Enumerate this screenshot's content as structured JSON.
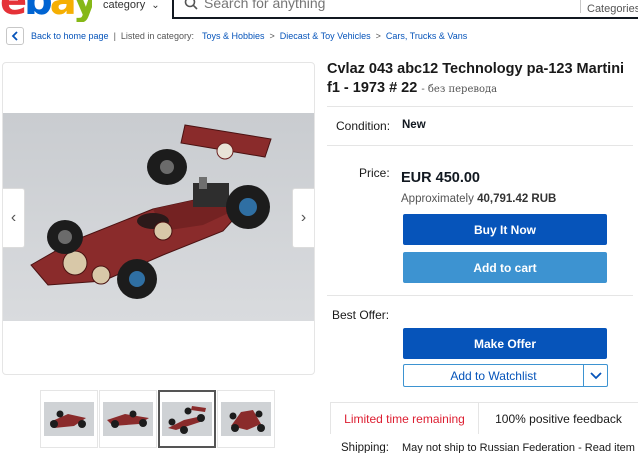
{
  "header": {
    "logo_text": "ebay",
    "category_label": "category",
    "search_placeholder": "Search for anything",
    "search_category": "All Categories"
  },
  "breadcrumb": {
    "back_label": "Back to home page",
    "listed_in": "Listed in category:",
    "items": [
      "Toys & Hobbies",
      "Diecast & Toy Vehicles",
      "Cars, Trucks & Vans"
    ]
  },
  "listing": {
    "title": "Cvlaz 043 abc12 Technology pa-123 Martini f1 - 1973 # 22",
    "title_note": "без перевода",
    "condition_label": "Condition:",
    "condition_value": "New",
    "price_label": "Price:",
    "price_value": "EUR 450.00",
    "approx_prefix": "Approximately",
    "approx_value": "40,791.42 RUB",
    "buy_now_label": "Buy It Now",
    "add_to_cart_label": "Add to cart",
    "best_offer_label": "Best Offer:",
    "make_offer_label": "Make Offer",
    "watchlist_label": "Add to Watchlist",
    "limited_label": "Limited time remaining",
    "positive_label": "100% positive feedback",
    "shipping_label": "Shipping:",
    "shipping_value": "May not ship to Russian Federation - Read item"
  },
  "gallery": {
    "selected_index": 2,
    "thumb_count": 4
  },
  "colors": {
    "primary_blue": "#0654ba",
    "secondary_blue": "#3d93d1",
    "alert_red": "#dd1e31",
    "car_red": "#8a2b2b"
  }
}
